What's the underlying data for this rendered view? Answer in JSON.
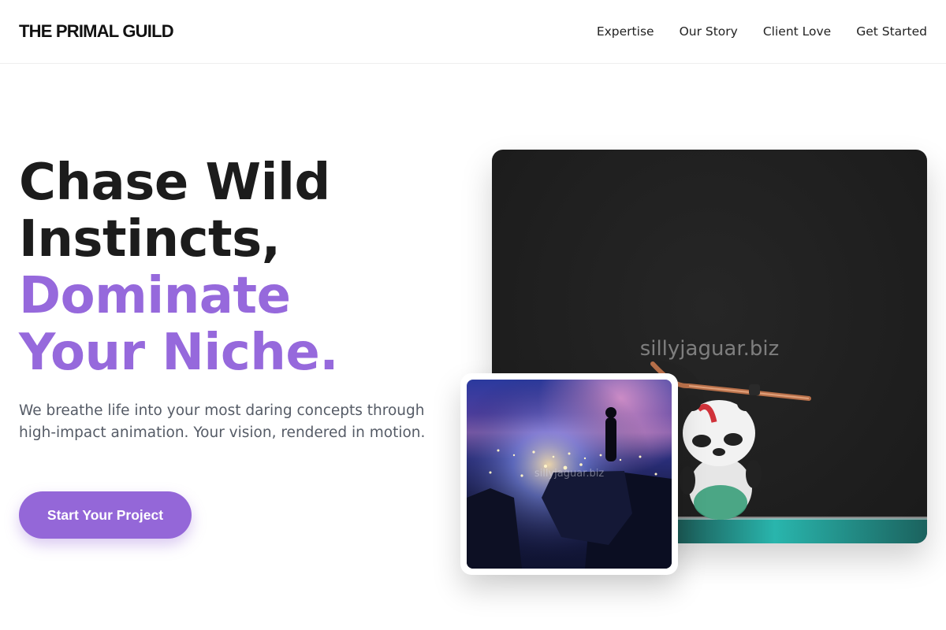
{
  "header": {
    "brand": "THE PRIMAL GUILD",
    "nav": [
      "Expertise",
      "Our Story",
      "Client Love",
      "Get Started"
    ]
  },
  "hero": {
    "headline_lines": [
      "Chase Wild",
      "Instincts,"
    ],
    "headline_accent_lines": [
      "Dominate",
      "Your Niche."
    ],
    "description": "We breathe life into your most daring concepts through high-impact animation. Your vision, rendered in motion.",
    "cta_label": "Start Your Project"
  },
  "media": {
    "main_image_watermark": "sillyjaguar.biz",
    "inset_image_watermark": "sillyjaguar.biz"
  },
  "colors": {
    "accent": "#9669dc",
    "cta_background": "#9467d8",
    "heading": "#1c1c1c",
    "body_text": "#555b66"
  }
}
